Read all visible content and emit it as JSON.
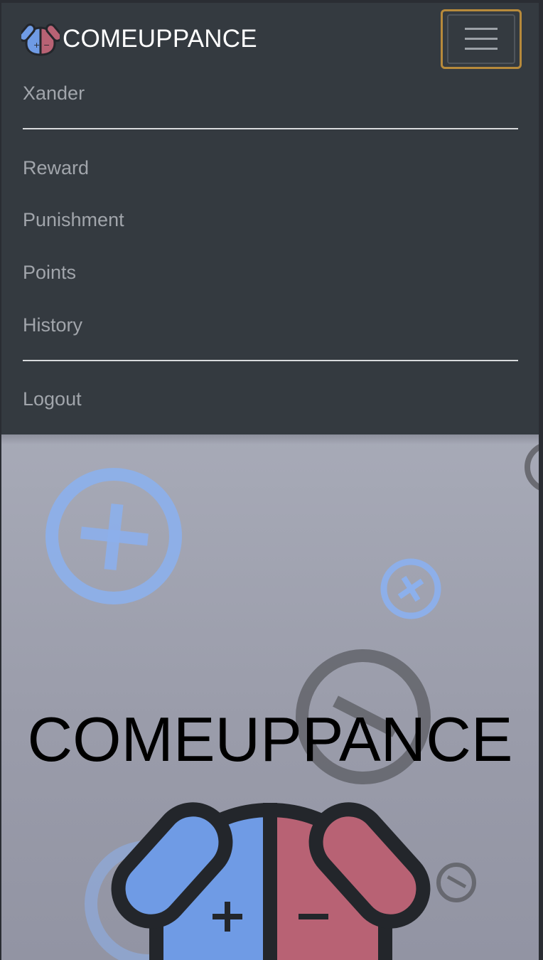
{
  "navbar": {
    "brand_text": "COMEUPPANCE",
    "logo_icon": "dog-face-logo-icon",
    "toggler_icon": "hamburger-menu-icon"
  },
  "menu": {
    "user": "Xander",
    "items": [
      {
        "label": "Reward"
      },
      {
        "label": "Punishment"
      },
      {
        "label": "Points"
      },
      {
        "label": "History"
      }
    ],
    "logout": "Logout"
  },
  "hero": {
    "title": "COMEUPPANCE",
    "logo_plus": "+",
    "logo_minus": "−"
  },
  "colors": {
    "navbar_bg": "#343a40",
    "nav_text": "#a1a5ab",
    "brand_text": "#ffffff",
    "toggler_focus": "#b78a3b",
    "plus_blue": "#6f9be5",
    "minus_red": "#b86274",
    "outline_dark": "#23262b"
  }
}
